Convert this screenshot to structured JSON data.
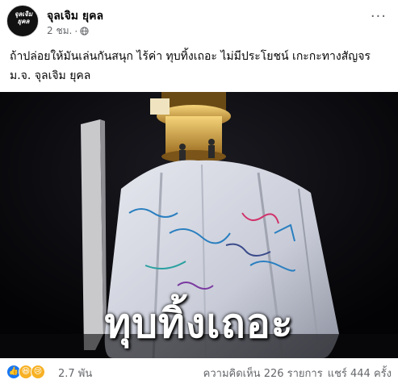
{
  "page": {
    "name": "จุลเจิม ยุคล",
    "avatar_text": "จุลเจิม\nยุคล",
    "time": "2 ชม.",
    "privacy_icon": "globe-icon",
    "more_label": "···"
  },
  "post": {
    "line1": "ถ้าปล่อยให้มันเล่นกันสนุก ไร้ค่า ทุบทิ้งเถอะ ไม่มีประโยชน์ เกะกะทางสัญจร",
    "line2": "ม.จ. จุลเจิม ยุคล"
  },
  "image": {
    "caption": "ทุบทิ้งเถอะ"
  },
  "footer": {
    "reactions": [
      "like-icon",
      "haha-icon",
      "sad-icon"
    ],
    "reaction_count": "2.7 พัน",
    "comments": "ความคิดเห็น 226 รายการ",
    "shares": "แชร์ 444 ครั้ง"
  },
  "colors": {
    "like": "#1877f2",
    "haha": "#f7b125",
    "sad": "#f7b125",
    "meta_gray": "#65676b"
  }
}
